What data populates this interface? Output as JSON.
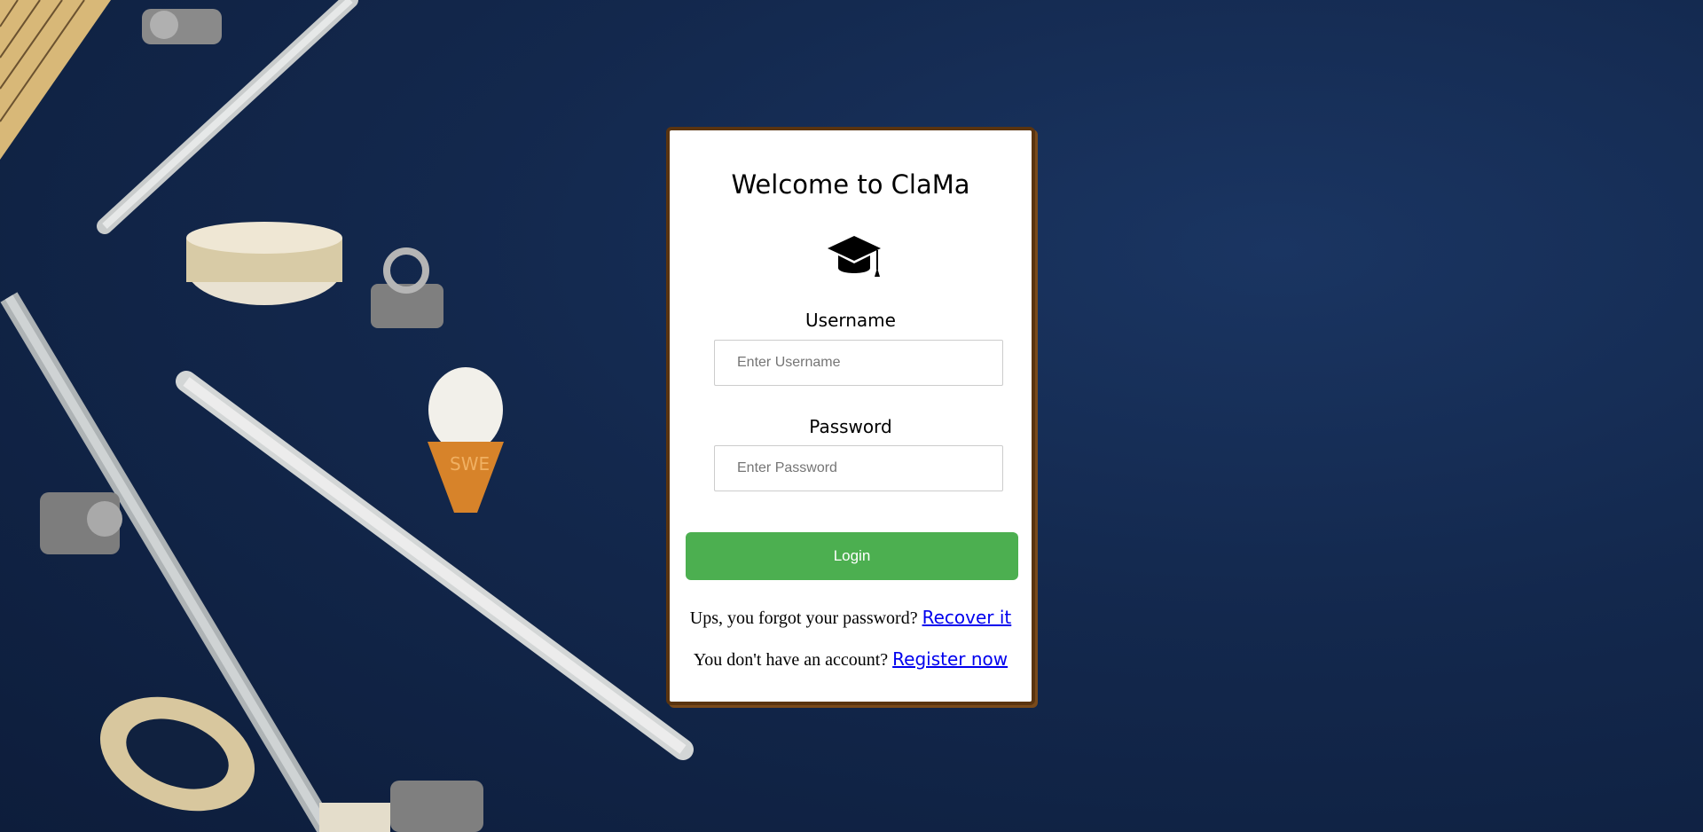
{
  "page": {
    "title": "Welcome to ClaMa",
    "logo_icon": "graduation-cap-icon"
  },
  "form": {
    "username_label": "Username",
    "username_placeholder": "Enter Username",
    "username_value": "",
    "password_label": "Password",
    "password_placeholder": "Enter Password",
    "password_value": "",
    "login_label": "Login"
  },
  "links": {
    "forgot_text": "Ups, you forgot your password?",
    "forgot_link": "Recover it",
    "register_text": "You don't have an account?",
    "register_link": "Register now"
  },
  "colors": {
    "background": "#13284d",
    "card_border": "#5a3410",
    "button": "#4caf50",
    "link": "#0000ee"
  },
  "background_photo": {
    "ice_cream_label": "SWE"
  }
}
